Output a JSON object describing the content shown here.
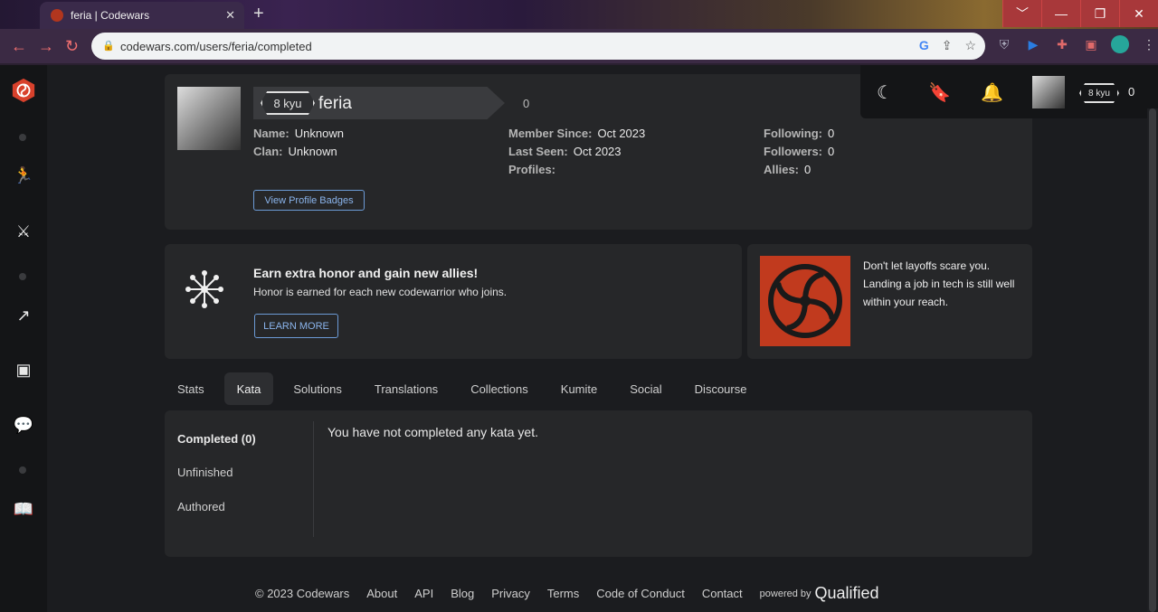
{
  "browser": {
    "tab_title": "feria | Codewars",
    "new_tab": "+",
    "url": "codewars.com/users/feria/completed",
    "window_controls": [
      "﹀",
      "—",
      "❐",
      "✕"
    ]
  },
  "sidebar": {
    "icons": [
      "codewars-logo-icon",
      "training-icon",
      "practice-icon",
      "leaderboard-icon",
      "discord-icon",
      "discussion-icon",
      "docs-icon"
    ]
  },
  "profile": {
    "rank": "8 kyu",
    "username": "feria",
    "honor": "0",
    "name_label": "Name:",
    "name_value": "Unknown",
    "clan_label": "Clan:",
    "clan_value": "Unknown",
    "member_since_label": "Member Since:",
    "member_since_value": "Oct 2023",
    "last_seen_label": "Last Seen:",
    "last_seen_value": "Oct 2023",
    "profiles_label": "Profiles:",
    "following_label": "Following:",
    "following_value": "0",
    "followers_label": "Followers:",
    "followers_value": "0",
    "allies_label": "Allies:",
    "allies_value": "0",
    "badges_button": "View Profile Badges"
  },
  "promo": {
    "title": "Earn extra honor and gain new allies!",
    "subtitle": "Honor is earned for each new codewarrior who joins.",
    "button": "LEARN MORE"
  },
  "ad": {
    "text": "Don't let layoffs scare you. Landing a job in tech is still well within your reach."
  },
  "tabs": [
    {
      "label": "Stats"
    },
    {
      "label": "Kata"
    },
    {
      "label": "Solutions"
    },
    {
      "label": "Translations"
    },
    {
      "label": "Collections"
    },
    {
      "label": "Kumite"
    },
    {
      "label": "Social"
    },
    {
      "label": "Discourse"
    }
  ],
  "kata": {
    "side": [
      "Completed (0)",
      "Unfinished",
      "Authored"
    ],
    "empty_message": "You have not completed any kata yet."
  },
  "footer": {
    "copyright": "© 2023 Codewars",
    "links": [
      "About",
      "API",
      "Blog",
      "Privacy",
      "Terms",
      "Code of Conduct",
      "Contact"
    ],
    "powered_by": "powered by",
    "qualified": "Qualified"
  },
  "topbar": {
    "rank": "8 kyu",
    "honor": "0"
  },
  "colors": {
    "accent": "#b1361e",
    "link": "#8ab4ec",
    "card": "#262729",
    "background": "#1b1c1f"
  }
}
